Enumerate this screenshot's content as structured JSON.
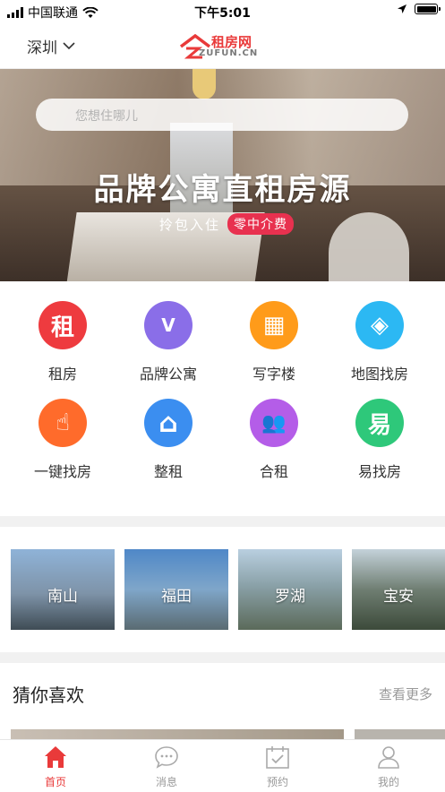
{
  "status_bar": {
    "carrier": "中国联通",
    "time": "下午5:01"
  },
  "nav": {
    "city": "深圳",
    "logo_cn": "租房网",
    "logo_en": "ZUFUN.CN"
  },
  "banner": {
    "search_placeholder": "您想住哪儿",
    "title": "品牌公寓直租房源",
    "subtitle": "拎包入住",
    "badge": "零中介费"
  },
  "categories": [
    {
      "label": "租房",
      "icon": "租"
    },
    {
      "label": "品牌公寓",
      "icon": "V"
    },
    {
      "label": "写字楼",
      "icon": "▦"
    },
    {
      "label": "地图找房",
      "icon": "◈"
    },
    {
      "label": "一键找房",
      "icon": "☝"
    },
    {
      "label": "整租",
      "icon": "⌂"
    },
    {
      "label": "合租",
      "icon": "👥"
    },
    {
      "label": "易找房",
      "icon": "易"
    }
  ],
  "category_colors": [
    "#ee3b3f",
    "#8a6ee8",
    "#ff9b1a",
    "#2cb8f3",
    "#ff6b2b",
    "#3b8ef0",
    "#b45de8",
    "#2ec87a"
  ],
  "areas": [
    {
      "name": "南山"
    },
    {
      "name": "福田"
    },
    {
      "name": "罗湖"
    },
    {
      "name": "宝安"
    }
  ],
  "guess": {
    "title": "猜你喜欢",
    "more": "查看更多"
  },
  "tabs": [
    {
      "label": "首页",
      "icon": "home-icon",
      "active": true
    },
    {
      "label": "消息",
      "icon": "chat-icon",
      "active": false
    },
    {
      "label": "预约",
      "icon": "calendar-check-icon",
      "active": false
    },
    {
      "label": "我的",
      "icon": "user-icon",
      "active": false
    }
  ],
  "accent_color": "#e93a3a"
}
